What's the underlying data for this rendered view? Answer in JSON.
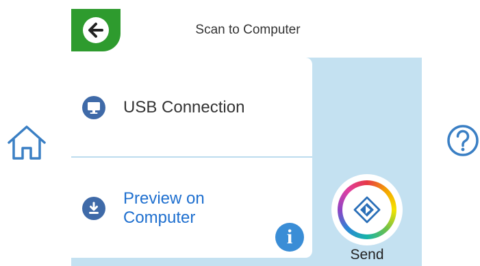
{
  "header": {
    "title": "Scan to Computer",
    "back_icon": "arrow-left-icon"
  },
  "options": [
    {
      "label": "USB Connection",
      "icon": "monitor-icon"
    },
    {
      "label": "Preview on\nComputer",
      "icon": "download-icon"
    }
  ],
  "info_icon": {
    "glyph": "i"
  },
  "send": {
    "label": "Send",
    "icon": "start-diamond-icon"
  },
  "side": {
    "home_icon": "home-icon",
    "help_icon": "help-icon"
  },
  "colors": {
    "back_green": "#2e9b2e",
    "panel_blue": "#c4e1f1",
    "item_icon_blue": "#3f6aa8",
    "link_blue": "#1e6fcf",
    "info_blue": "#3a8dd6"
  }
}
